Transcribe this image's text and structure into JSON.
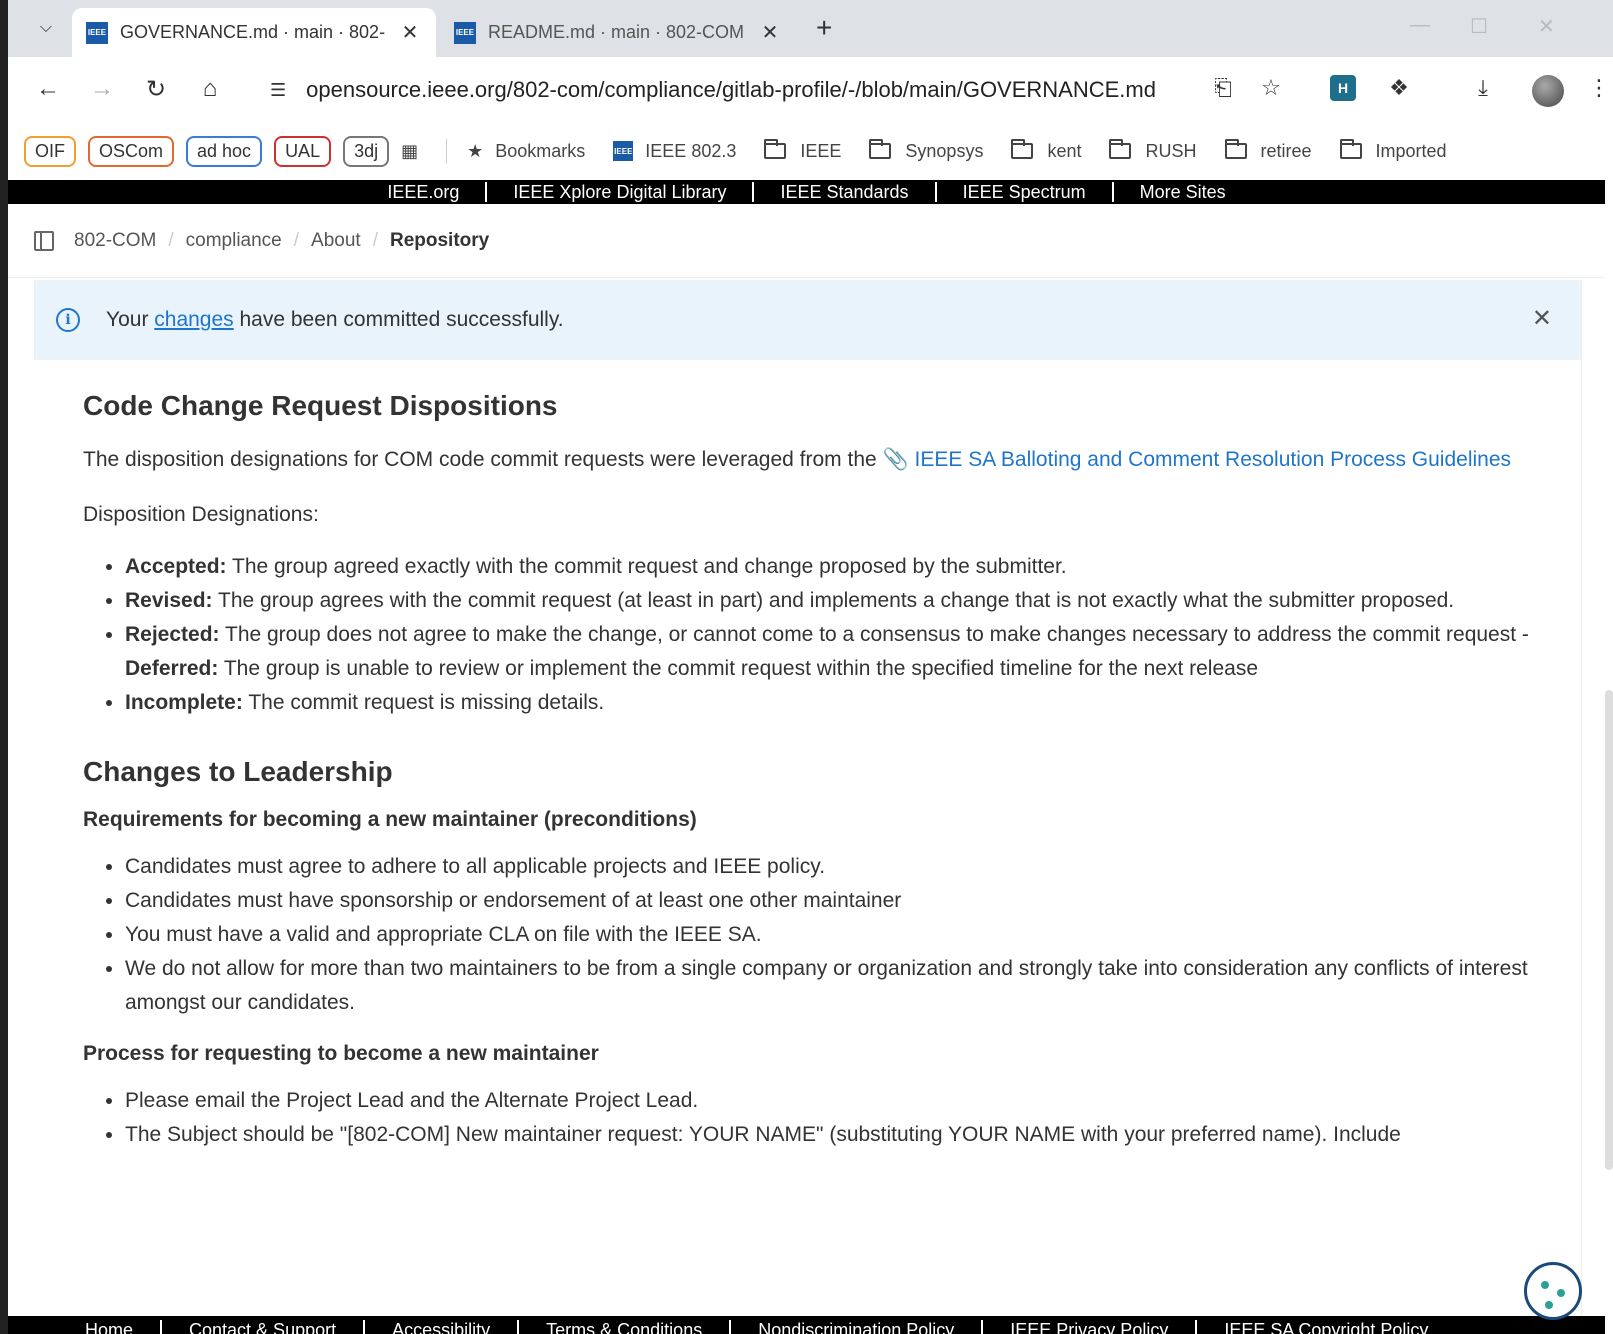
{
  "browser": {
    "tabs": [
      {
        "title": "GOVERNANCE.md · main · 802-",
        "active": true,
        "favicon": "IEEE"
      },
      {
        "title": "README.md · main · 802-COM",
        "active": false,
        "favicon": "IEEE"
      }
    ],
    "url": "opensource.ieee.org/802-com/compliance/gitlab-profile/-/blob/main/GOVERNANCE.md",
    "extension_label": "H"
  },
  "bookmarks": {
    "chips": [
      {
        "label": "OIF",
        "color": "#f0a030"
      },
      {
        "label": "OSCom",
        "color": "#e06a30"
      },
      {
        "label": "ad hoc",
        "color": "#3a7bd5"
      },
      {
        "label": "UAL",
        "color": "#d03030"
      },
      {
        "label": "3dj",
        "color": "#777777"
      }
    ],
    "bookmarks_label": "Bookmarks",
    "ieee_label": "IEEE 802.3",
    "folders": [
      "IEEE",
      "Synopsys",
      "kent",
      "RUSH",
      "retiree",
      "Imported"
    ]
  },
  "ieee_nav": {
    "items": [
      "IEEE.org",
      "IEEE Xplore Digital Library",
      "IEEE Standards",
      "IEEE Spectrum",
      "More Sites"
    ]
  },
  "breadcrumb": {
    "items": [
      "802-COM",
      "compliance",
      "About",
      "Repository"
    ]
  },
  "alert": {
    "prefix": "Your ",
    "link": "changes",
    "suffix": " have been committed successfully."
  },
  "content": {
    "section1_title": "Code Change Request Dispositions",
    "section1_intro": "The disposition designations for COM code commit requests were leveraged from the ",
    "section1_link": "IEEE SA Balloting and Comment Resolution Process Guidelines",
    "designations_label": "Disposition Designations:",
    "designations": [
      {
        "term": "Accepted:",
        "text": " The group agreed exactly with the commit request and change proposed by the submitter."
      },
      {
        "term": "Revised:",
        "text": " The group agrees with the commit request (at least in part) and implements a change that is not exactly what the submitter proposed."
      },
      {
        "term": "Rejected:",
        "text": " The group does not agree to make the change, or cannot come to a consensus to make changes necessary to address the commit request - ",
        "term2": "Deferred:",
        "text2": " The group is unable to review or implement the commit request within the specified timeline for the next release"
      },
      {
        "term": "Incomplete:",
        "text": " The commit request is missing details."
      }
    ],
    "section2_title": "Changes to Leadership",
    "req_title": "Requirements for becoming a new maintainer (preconditions)",
    "requirements": [
      "Candidates must agree to adhere to all applicable projects and IEEE policy.",
      "Candidates must have sponsorship or endorsement of at least one other maintainer",
      "You must have a valid and appropriate CLA on file with the IEEE SA.",
      "We do not allow for more than two maintainers to be from a single company or organization and strongly take into consideration any conflicts of interest amongst our candidates."
    ],
    "process_title": "Process for requesting to become a new maintainer",
    "process": [
      "Please email the Project Lead and the Alternate Project Lead.",
      "The Subject should be \"[802-COM] New maintainer request: YOUR NAME\" (substituting YOUR NAME with your preferred name). Include"
    ]
  },
  "footer": {
    "items": [
      "Home",
      "Contact & Support",
      "Accessibility",
      "Terms & Conditions",
      "Nondiscrimination Policy",
      "IEEE Privacy Policy",
      "IEEE SA Copyright Policy"
    ]
  }
}
